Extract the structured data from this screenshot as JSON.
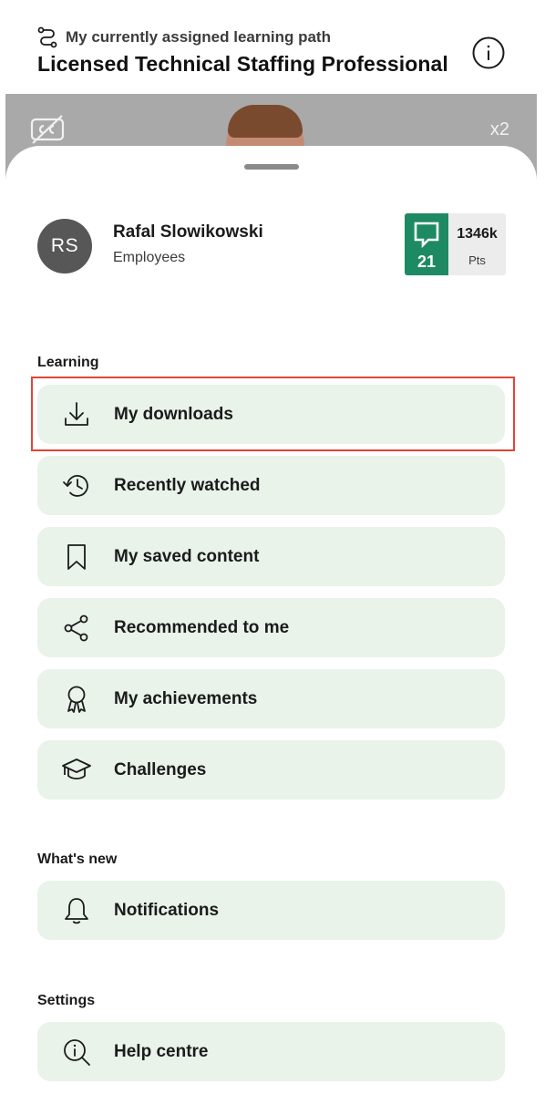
{
  "header": {
    "path_label": "My currently assigned learning path",
    "path_title": "Licensed Technical Staffing Professional"
  },
  "video": {
    "speed": "x2"
  },
  "profile": {
    "initials": "RS",
    "name": "Rafal Slowikowski",
    "role": "Employees",
    "count": "21",
    "points_value": "1346k",
    "points_label": "Pts",
    "accent": "#1e8a63"
  },
  "sections": {
    "learning": "Learning",
    "whats_new": "What's new",
    "settings": "Settings"
  },
  "menu": {
    "downloads": "My downloads",
    "recent": "Recently watched",
    "saved": "My saved content",
    "recommended": "Recommended to me",
    "achievements": "My achievements",
    "challenges": "Challenges",
    "notifications": "Notifications",
    "help": "Help centre"
  },
  "colors": {
    "item_bg": "#e9f3e9",
    "highlight": "#e0453a"
  }
}
